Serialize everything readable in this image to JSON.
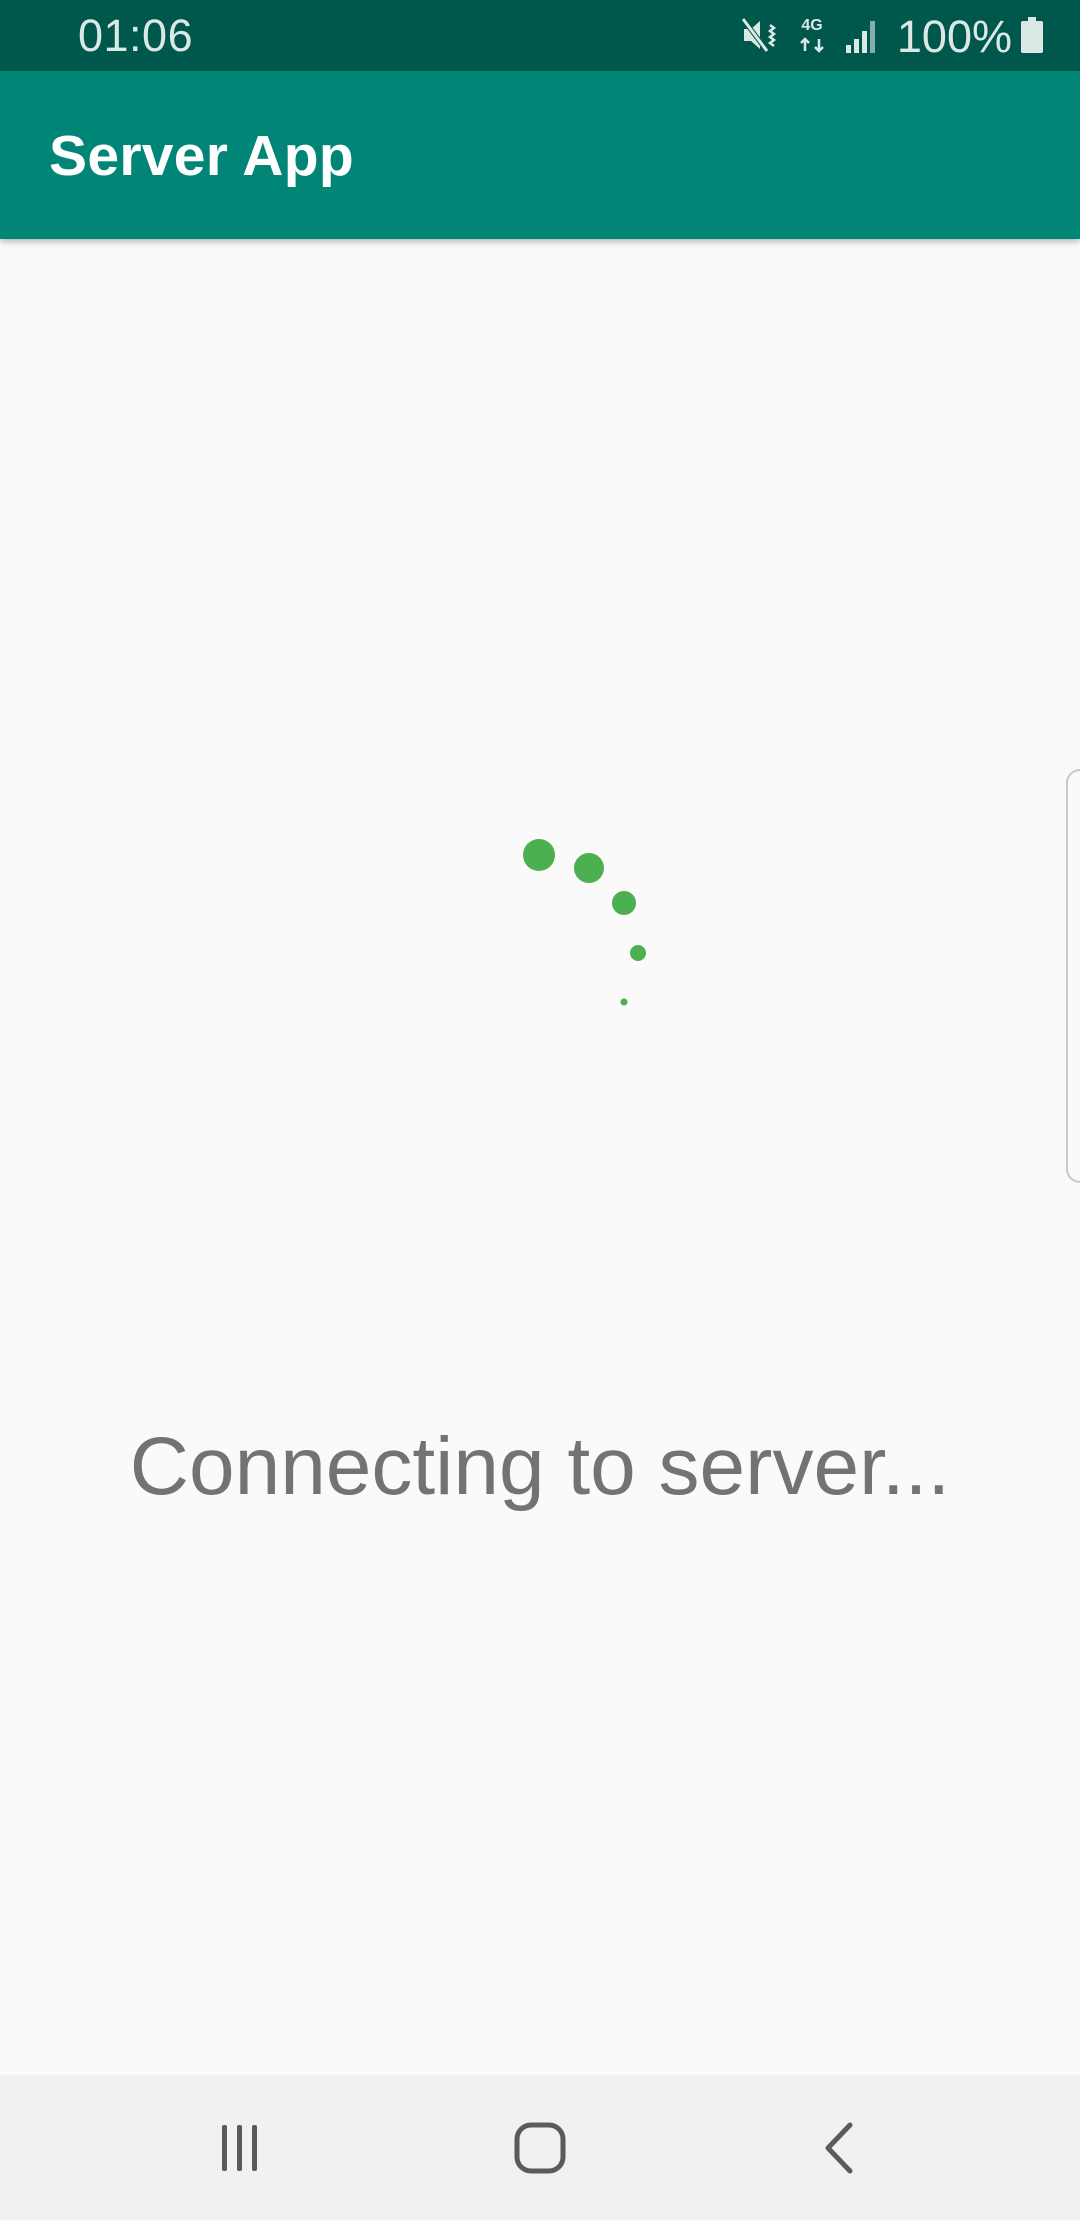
{
  "status_bar": {
    "time": "01:06",
    "network_type": "4G",
    "battery": "100%",
    "icons": [
      "mute-vibrate-icon",
      "network-4g-icon",
      "signal-icon",
      "battery-icon"
    ]
  },
  "app_bar": {
    "title": "Server App"
  },
  "main": {
    "loading_message": "Connecting to server...",
    "spinner_color": "#4caf50"
  },
  "nav_bar": {
    "buttons": [
      "recent-apps",
      "home",
      "back"
    ]
  },
  "colors": {
    "status_bar": "#00574b",
    "app_bar": "#008577",
    "background": "#fafafa",
    "message_text": "#737373",
    "nav_bar": "#f1f1f1"
  }
}
